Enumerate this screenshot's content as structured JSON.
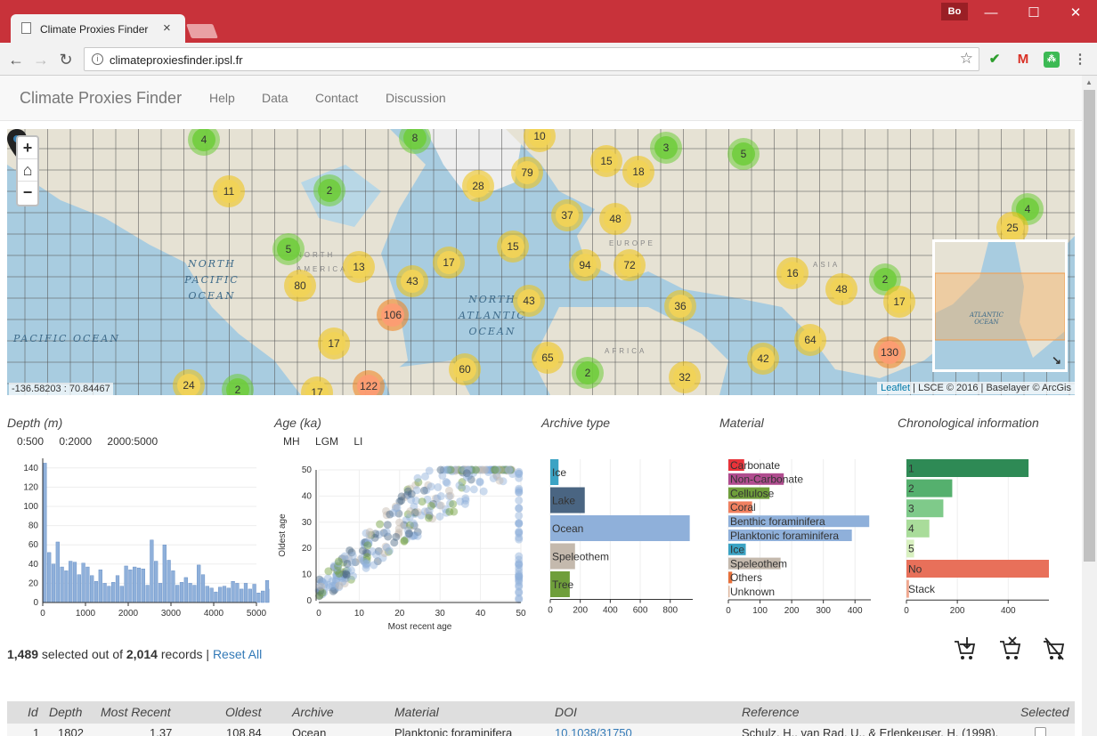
{
  "browser": {
    "tab_title": "Climate Proxies Finder",
    "tab_close": "×",
    "profile": "Bo",
    "url": "climateproxiesfinder.ipsl.fr",
    "minimize": "—",
    "maximize": "☐",
    "close": "✕"
  },
  "nav": {
    "brand": "Climate Proxies Finder",
    "links": [
      "Help",
      "Data",
      "Contact",
      "Discussion"
    ]
  },
  "map": {
    "zoom_in": "+",
    "home": "⌂",
    "zoom_out": "−",
    "coords": "-136.58203 : 70.84467",
    "attribution_link": "Leaflet",
    "attribution_rest": " | LSCE © 2016 | Baselayer © ArcGis",
    "ocean_labels": [
      "NORTH PACIFIC OCEAN",
      "NORTH ATLANTIC OCEAN",
      "PACIFIC OCEAN"
    ],
    "continent_labels": [
      "NORTH AMERICA",
      "EUROPE",
      "AFRICA",
      "ASIA"
    ],
    "minimap_label": "ATLANTIC OCEAN",
    "clusters": [
      {
        "n": "4",
        "c": "green"
      },
      {
        "n": "8",
        "c": "green"
      },
      {
        "n": "10",
        "c": "yellow"
      },
      {
        "n": "3",
        "c": "green"
      },
      {
        "n": "5",
        "c": "green"
      },
      {
        "n": "11",
        "c": "yellow"
      },
      {
        "n": "2",
        "c": "green"
      },
      {
        "n": "28",
        "c": "yellow"
      },
      {
        "n": "79",
        "c": "yellow"
      },
      {
        "n": "15",
        "c": "yellow"
      },
      {
        "n": "18",
        "c": "yellow"
      },
      {
        "n": "37",
        "c": "yellow"
      },
      {
        "n": "48",
        "c": "yellow"
      },
      {
        "n": "4",
        "c": "green"
      },
      {
        "n": "25",
        "c": "yellow"
      },
      {
        "n": "5",
        "c": "green"
      },
      {
        "n": "15",
        "c": "yellow"
      },
      {
        "n": "17",
        "c": "yellow"
      },
      {
        "n": "13",
        "c": "yellow"
      },
      {
        "n": "94",
        "c": "yellow"
      },
      {
        "n": "72",
        "c": "yellow"
      },
      {
        "n": "16",
        "c": "yellow"
      },
      {
        "n": "48",
        "c": "yellow"
      },
      {
        "n": "2",
        "c": "green"
      },
      {
        "n": "80",
        "c": "yellow"
      },
      {
        "n": "43",
        "c": "yellow"
      },
      {
        "n": "43",
        "c": "yellow"
      },
      {
        "n": "17",
        "c": "yellow"
      },
      {
        "n": "106",
        "c": "orange"
      },
      {
        "n": "36",
        "c": "yellow"
      },
      {
        "n": "17",
        "c": "yellow"
      },
      {
        "n": "64",
        "c": "yellow"
      },
      {
        "n": "130",
        "c": "orange"
      },
      {
        "n": "60",
        "c": "yellow"
      },
      {
        "n": "65",
        "c": "yellow"
      },
      {
        "n": "2",
        "c": "green"
      },
      {
        "n": "42",
        "c": "yellow"
      },
      {
        "n": "32",
        "c": "yellow"
      },
      {
        "n": "24",
        "c": "yellow"
      },
      {
        "n": "2",
        "c": "green"
      },
      {
        "n": "17",
        "c": "yellow"
      },
      {
        "n": "122",
        "c": "orange"
      }
    ]
  },
  "charts": {
    "depth": {
      "title": "Depth (m)",
      "filters": [
        "0:500",
        "0:2000",
        "2000:5000"
      ]
    },
    "age": {
      "title": "Age (ka)",
      "filters": [
        "MH",
        "LGM",
        "LI"
      ]
    },
    "archive": {
      "title": "Archive type"
    },
    "material": {
      "title": "Material"
    },
    "chrono": {
      "title": "Chronological information"
    }
  },
  "chart_data": [
    {
      "type": "bar",
      "title": "Depth (m)",
      "xlim": [
        0,
        5000
      ],
      "ylim": [
        0,
        145
      ],
      "x_ticks": [
        "0",
        "1000",
        "2000",
        "3000",
        "4000",
        "5000"
      ],
      "y_ticks": [
        "0",
        "20",
        "40",
        "60",
        "80",
        "100",
        "120",
        "140"
      ],
      "bin_width": 100,
      "values": [
        145,
        52,
        40,
        63,
        37,
        33,
        43,
        42,
        29,
        41,
        37,
        28,
        22,
        34,
        20,
        17,
        21,
        28,
        17,
        38,
        34,
        37,
        36,
        35,
        18,
        65,
        43,
        20,
        60,
        44,
        33,
        18,
        21,
        26,
        20,
        18,
        39,
        29,
        17,
        15,
        11,
        16,
        17,
        15,
        22,
        20,
        14,
        20,
        14,
        19,
        10,
        12,
        23,
        14,
        9,
        21,
        11,
        20,
        12,
        15
      ]
    },
    {
      "type": "scatter",
      "title": "Age (ka)",
      "xlabel": "Most recent age",
      "ylabel": "Oldest age",
      "xlim": [
        0,
        50
      ],
      "ylim": [
        0,
        50
      ],
      "x_ticks": [
        "0",
        "10",
        "20",
        "30",
        "40",
        "50"
      ],
      "y_ticks": [
        "0",
        "10",
        "20",
        "30",
        "40",
        "50"
      ]
    },
    {
      "type": "bar",
      "orientation": "horizontal",
      "title": "Archive type",
      "categories": [
        "Ice",
        "Lake",
        "Ocean",
        "Speleothem",
        "Tree"
      ],
      "values": [
        55,
        230,
        930,
        165,
        130
      ],
      "colors": [
        "#3ba3c4",
        "#4a6582",
        "#8fb0da",
        "#c4b9ad",
        "#6f9e3b"
      ],
      "xlim": [
        0,
        950
      ],
      "x_ticks": [
        "0",
        "200",
        "400",
        "600",
        "800"
      ]
    },
    {
      "type": "bar",
      "orientation": "horizontal",
      "title": "Material",
      "categories": [
        "Carbonate",
        "Non-Carbonate",
        "Cellulose",
        "Coral",
        "Benthic foraminifera",
        "Planktonic foraminifera",
        "Ice",
        "Speleothem",
        "Others",
        "Unknown"
      ],
      "values": [
        50,
        175,
        130,
        75,
        445,
        390,
        55,
        165,
        12,
        4
      ],
      "colors": [
        "#e8333a",
        "#b04c8f",
        "#6f9e3b",
        "#f08060",
        "#8fb0da",
        "#8fb0da",
        "#3ba3c4",
        "#c4b9ad",
        "#e8703a",
        "#e0b8a0"
      ],
      "xlim": [
        0,
        450
      ],
      "x_ticks": [
        "0",
        "100",
        "200",
        "300",
        "400"
      ]
    },
    {
      "type": "bar",
      "orientation": "horizontal",
      "title": "Chronological information",
      "categories": [
        "1",
        "2",
        "3",
        "4",
        "5",
        "No",
        "Stack"
      ],
      "values": [
        480,
        180,
        145,
        90,
        30,
        560,
        10
      ],
      "colors": [
        "#2e8a55",
        "#55b06e",
        "#7fca8a",
        "#a9dc9a",
        "#d8f0c0",
        "#e8705a",
        "#f0a890"
      ],
      "xlim": [
        0,
        560
      ],
      "x_ticks": [
        "0",
        "200",
        "400"
      ]
    }
  ],
  "summary": {
    "selected": "1,489",
    "selected_text": " selected out of ",
    "total": "2,014",
    "records_text": " records | ",
    "reset": "Reset All"
  },
  "table": {
    "headers": [
      "Id",
      "Depth",
      "Most Recent",
      "Oldest",
      "Archive",
      "Material",
      "DOI",
      "Reference",
      "Selected"
    ],
    "rows": [
      {
        "id": "1",
        "depth": "1802",
        "recent": "1.37",
        "oldest": "108.84",
        "archive": "Ocean",
        "material": "Planktonic foraminifera",
        "doi": "10.1038/31750",
        "reference": "Schulz, H., van Rad, U., & Erlenkeuser, H. (1998)."
      }
    ]
  }
}
